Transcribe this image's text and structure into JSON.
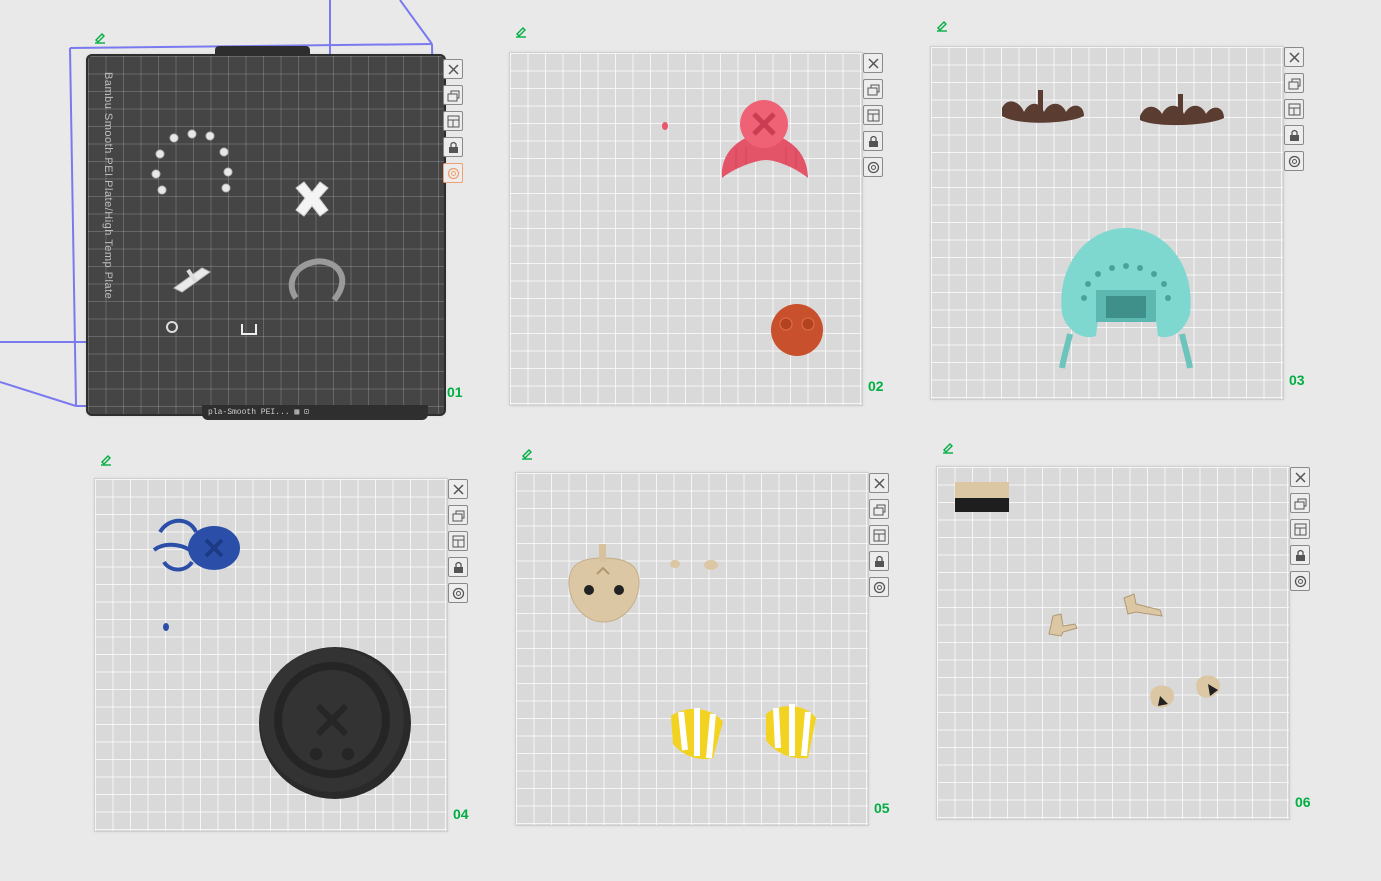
{
  "plates": [
    {
      "number": "01",
      "label": "Bambu Smooth PEI Plate/High Temp Plate",
      "status": "pla-Smooth PEI...   ▦ ⊡",
      "selected": true
    },
    {
      "number": "02",
      "selected": false
    },
    {
      "number": "03",
      "selected": false
    },
    {
      "number": "04",
      "selected": false
    },
    {
      "number": "05",
      "selected": false
    },
    {
      "number": "06",
      "selected": false
    }
  ],
  "toolbar_icons": [
    "close-icon",
    "arrange-icon",
    "orient-icon",
    "lock-icon",
    "settings-icon"
  ],
  "colors": {
    "accent_green": "#00ae42",
    "selection_blue": "#7a7af0",
    "plate_grey": "#d9d9d9",
    "plate_dark": "#454545",
    "pink_part": "#e8566a",
    "orange_part": "#c9502c",
    "brown_part": "#5a3c30",
    "cyan_part": "#7fd8d0",
    "blue_part": "#2b4fa8",
    "black_part": "#2a2a2a",
    "tan_part": "#dcc7a5",
    "yellow_part": "#f2d321"
  }
}
